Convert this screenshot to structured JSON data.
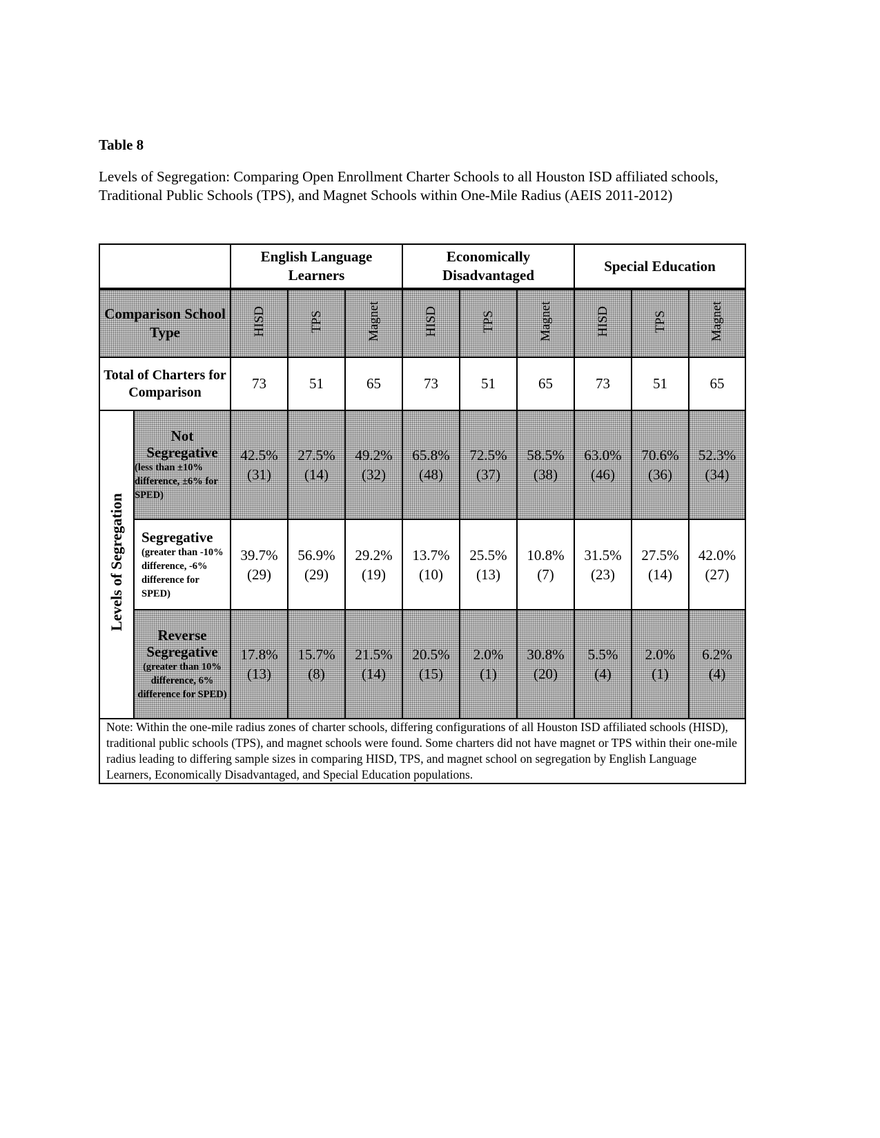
{
  "document": {
    "table_label": "Table 8",
    "caption": "Levels of Segregation: Comparing Open Enrollment Charter Schools to all Houston ISD affiliated schools, Traditional Public Schools (TPS), and Magnet Schools within One-Mile Radius (AEIS 2011-2012)"
  },
  "table": {
    "groups": [
      "English Language Learners",
      "Economically Disadvantaged",
      "Special Education"
    ],
    "comparison_label": "Comparison School Type",
    "school_types": [
      "HISD",
      "TPS",
      "Magnet",
      "HISD",
      "TPS",
      "Magnet",
      "HISD",
      "TPS",
      "Magnet"
    ],
    "total_label": "Total of Charters for Comparison",
    "totals": [
      "73",
      "51",
      "65",
      "73",
      "51",
      "65",
      "73",
      "51",
      "65"
    ],
    "levels_label": "Levels of Segregation",
    "rows": [
      {
        "title": "Not Segregative",
        "desc": "(less than ±10% difference, ±6% for SPED)",
        "cells": [
          {
            "pct": "42.5%",
            "n": "(31)"
          },
          {
            "pct": "27.5%",
            "n": "(14)"
          },
          {
            "pct": "49.2%",
            "n": "(32)"
          },
          {
            "pct": "65.8%",
            "n": "(48)"
          },
          {
            "pct": "72.5%",
            "n": "(37)"
          },
          {
            "pct": "58.5%",
            "n": "(38)"
          },
          {
            "pct": "63.0%",
            "n": "(46)"
          },
          {
            "pct": "70.6%",
            "n": "(36)"
          },
          {
            "pct": "52.3%",
            "n": "(34)"
          }
        ]
      },
      {
        "title": "Segregative",
        "desc": "(greater than -10% difference, -6% difference for SPED)",
        "cells": [
          {
            "pct": "39.7%",
            "n": "(29)"
          },
          {
            "pct": "56.9%",
            "n": "(29)"
          },
          {
            "pct": "29.2%",
            "n": "(19)"
          },
          {
            "pct": "13.7%",
            "n": "(10)"
          },
          {
            "pct": "25.5%",
            "n": "(13)"
          },
          {
            "pct": "10.8%",
            "n": "(7)"
          },
          {
            "pct": "31.5%",
            "n": "(23)"
          },
          {
            "pct": "27.5%",
            "n": "(14)"
          },
          {
            "pct": "42.0%",
            "n": "(27)"
          }
        ]
      },
      {
        "title": "Reverse Segregative",
        "desc": "(greater than 10% difference, 6% difference for SPED)",
        "cells": [
          {
            "pct": "17.8%",
            "n": "(13)"
          },
          {
            "pct": "15.7%",
            "n": "(8)"
          },
          {
            "pct": "21.5%",
            "n": "(14)"
          },
          {
            "pct": "20.5%",
            "n": "(15)"
          },
          {
            "pct": "2.0%",
            "n": "(1)"
          },
          {
            "pct": "30.8%",
            "n": "(20)"
          },
          {
            "pct": "5.5%",
            "n": "(4)"
          },
          {
            "pct": "2.0%",
            "n": "(1)"
          },
          {
            "pct": "6.2%",
            "n": "(4)"
          }
        ]
      }
    ],
    "note": "Note: Within the one-mile radius zones of charter schools, differing configurations of all Houston ISD affiliated schools (HISD), traditional public schools (TPS), and magnet schools were found.  Some charters did not have magnet or TPS within their one-mile radius leading to differing sample sizes in comparing HISD, TPS, and magnet school on segregation by English Language Learners, Economically Disadvantaged, and Special Education populations."
  }
}
